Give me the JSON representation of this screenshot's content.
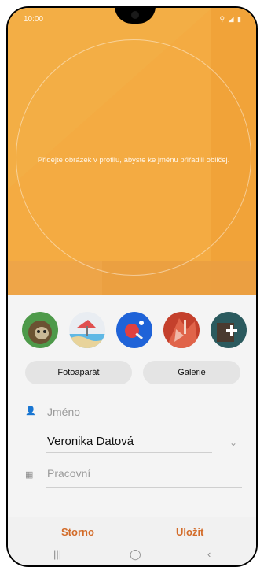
{
  "status_bar": {
    "time": "10:00",
    "icons": "⚲ ◢ ▮"
  },
  "hero": {
    "hint": "Přidejte obrázek v profilu, abyste ke jménu přiřadili obličej."
  },
  "avatars": [
    "avatar-sloth",
    "avatar-beach",
    "avatar-pingpong",
    "avatar-paint",
    "avatar-add"
  ],
  "buttons": {
    "camera": "Fotoaparát",
    "gallery": "Galerie"
  },
  "fields": {
    "name_label": "Jméno",
    "name_value": "Veronika Datová",
    "work_label": "Pracovní"
  },
  "actions": {
    "cancel": "Storno",
    "save": "Uložit"
  },
  "nav": {
    "recent": "|||",
    "home": "◯",
    "back": "‹"
  },
  "colors": {
    "hero": "#f4ab42",
    "accent": "#d36c2a"
  }
}
